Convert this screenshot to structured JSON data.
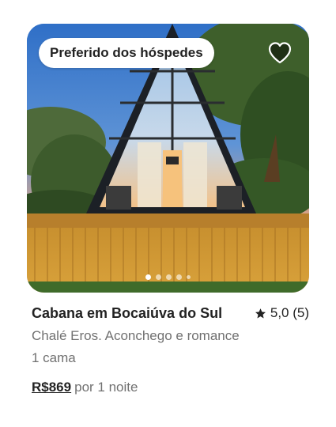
{
  "listing": {
    "badge": "Preferido dos hóspedes",
    "title": "Cabana em Bocaiúva do Sul",
    "rating": "5,0 (5)",
    "subtitle": "Chalé Eros. Aconchego e romance",
    "beds": "1 cama",
    "price": "R$869",
    "price_suffix": "por 1 noite"
  },
  "carousel": {
    "total_dots": 5,
    "active_dot": 1
  },
  "icons": {
    "favorite": "heart-icon",
    "rating": "star-icon"
  },
  "colors": {
    "text": "#222222",
    "secondary_text": "#717171",
    "badge_bg": "#ffffff"
  }
}
